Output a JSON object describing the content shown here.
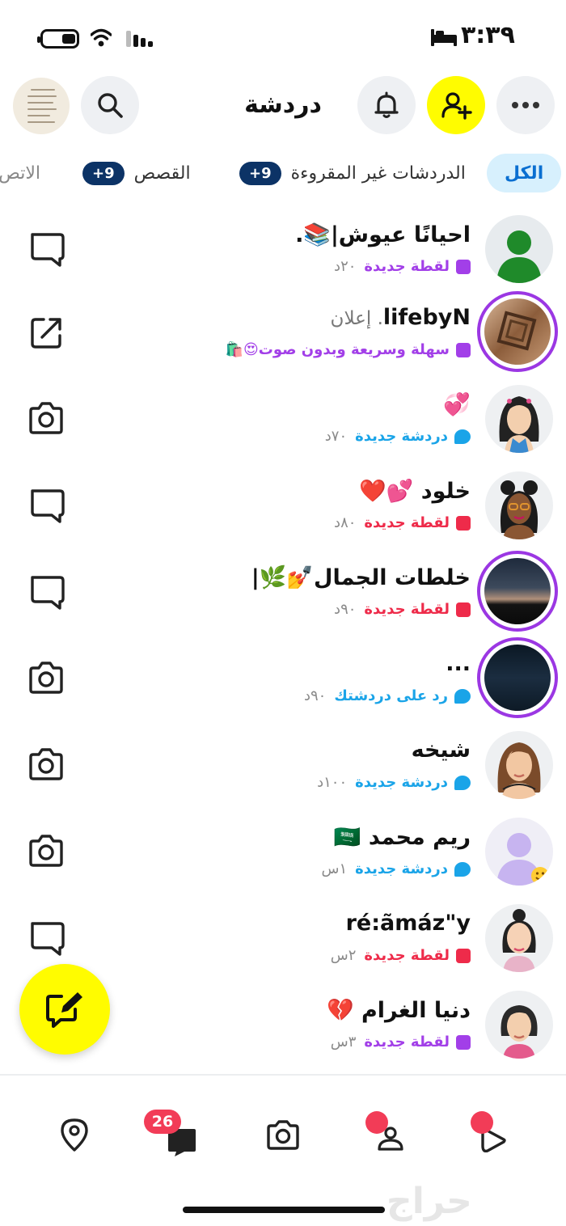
{
  "status_bar": {
    "time": "٣:٣٩"
  },
  "header": {
    "title": "دردشة"
  },
  "filters": [
    {
      "label": "الكل",
      "badge": ""
    },
    {
      "label": "الدردشات غير المقروءة",
      "badge": "+9"
    },
    {
      "label": "القصص",
      "badge": "+9"
    },
    {
      "label": "الاتص",
      "badge": ""
    }
  ],
  "chats": [
    {
      "name": "احيانًا عيوش|📚.",
      "name_suffix": "",
      "status": "لقطة جديدة",
      "time": "٢٠د",
      "status_color": "#a23fe8",
      "status_shape": "square",
      "action_icon": "chat-bubble-icon",
      "avatar": "silhouette-green"
    },
    {
      "name": "lifebyN",
      "name_suffix": ". إعلان",
      "status": "سهلة وسريعة وبدون صوت😍🛍️",
      "time": "",
      "status_color": "#a23fe8",
      "status_shape": "square",
      "action_icon": "external-link-icon",
      "avatar": "story-box"
    },
    {
      "name": "💞",
      "name_suffix": "",
      "status": "دردشة جديدة",
      "time": "٧٠د",
      "status_color": "#1aa4e8",
      "status_shape": "bubble",
      "action_icon": "camera-icon",
      "avatar": "bitmoji-girl-black-hair"
    },
    {
      "name": "خلود 💕❤️",
      "name_suffix": "",
      "status": "لقطة جديدة",
      "time": "٨٠د",
      "status_color": "#ee2b4a",
      "status_shape": "square",
      "action_icon": "chat-bubble-icon",
      "avatar": "bitmoji-dark-skin-glasses"
    },
    {
      "name": "خلطات الجمال💅🌿|",
      "name_suffix": "",
      "status": "لقطة جديدة",
      "time": "٩٠د",
      "status_color": "#ee2b4a",
      "status_shape": "square",
      "action_icon": "chat-bubble-icon",
      "avatar": "story-sunset"
    },
    {
      "name": "...",
      "name_suffix": "",
      "status": "رد على دردشتك",
      "time": "٩٠د",
      "status_color": "#1aa4e8",
      "status_shape": "bubble",
      "action_icon": "camera-icon",
      "avatar": "story-dark"
    },
    {
      "name": "شيخه",
      "name_suffix": "",
      "status": "دردشة جديدة",
      "time": "١٠٠د",
      "status_color": "#1aa4e8",
      "status_shape": "bubble",
      "action_icon": "camera-icon",
      "avatar": "bitmoji-brown-hair"
    },
    {
      "name": "ريم محمد 🇸🇦",
      "name_suffix": "",
      "status": "دردشة جديدة",
      "time": "١س",
      "status_color": "#1aa4e8",
      "status_shape": "bubble",
      "action_icon": "camera-icon",
      "avatar": "silhouette-purple"
    },
    {
      "name": "ré:ãmáz\"y",
      "name_suffix": "",
      "status": "لقطة جديدة",
      "time": "٢س",
      "status_color": "#ee2b4a",
      "status_shape": "square",
      "action_icon": "chat-bubble-icon",
      "avatar": "bitmoji-bun"
    },
    {
      "name": "دنيا الغرام 💔",
      "name_suffix": "",
      "status": "لقطة جديدة",
      "time": "٣س",
      "status_color": "#a23fe8",
      "status_shape": "square",
      "action_icon": "",
      "avatar": "bitmoji-short-hair"
    }
  ],
  "bottom_nav": {
    "chat_badge": "26"
  },
  "watermark": "حراج",
  "colors": {
    "snap_yellow": "#fffc00",
    "snap_purple": "#a23fe8",
    "snap_blue": "#1aa4e8",
    "snap_red": "#ee2b4a",
    "badge_red": "#f23c57",
    "chip_navy": "#0c3366"
  }
}
